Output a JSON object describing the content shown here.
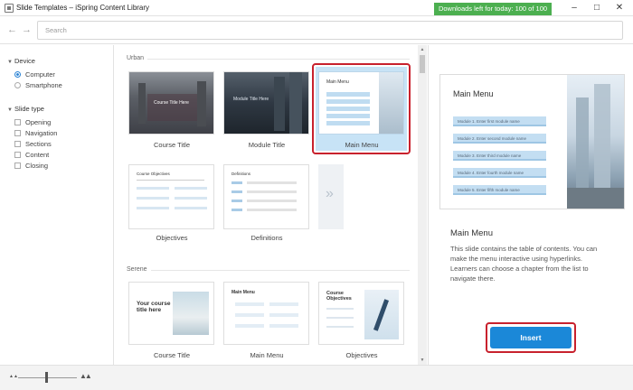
{
  "window": {
    "title": "Slide Templates – iSpring Content Library",
    "downloads": "Downloads left for today: 100 of 100"
  },
  "search": {
    "placeholder": "Search"
  },
  "filters": {
    "device": {
      "label": "Device",
      "options": [
        "Computer",
        "Smartphone"
      ],
      "selected": "Computer"
    },
    "slide_type": {
      "label": "Slide type",
      "options": [
        "Opening",
        "Navigation",
        "Sections",
        "Content",
        "Closing"
      ]
    }
  },
  "gallery": {
    "sections": [
      {
        "name": "Urban",
        "templates": [
          {
            "label": "Course Title",
            "thumb_text": "Course Title Here"
          },
          {
            "label": "Module Title",
            "thumb_text": "Module Title Here"
          },
          {
            "label": "Main Menu",
            "thumb_text": "Main Menu",
            "selected": true
          },
          {
            "label": "Objectives",
            "thumb_text": "Course Objectives"
          },
          {
            "label": "Definitions",
            "thumb_text": "Definitions"
          }
        ]
      },
      {
        "name": "Serene",
        "templates": [
          {
            "label": "Course Title",
            "thumb_text": "Your course title here"
          },
          {
            "label": "Main Menu",
            "thumb_text": "Main Menu"
          },
          {
            "label": "Objectives",
            "thumb_text": "Course Objectives"
          }
        ]
      }
    ]
  },
  "preview": {
    "slide_title": "Main Menu",
    "modules": [
      "Module 1. Enter first module name",
      "Module 2. Enter second module name",
      "Module 3. Enter third module name",
      "Module 4. Enter fourth module name",
      "Module 5. Enter fifth module name"
    ],
    "name": "Main Menu",
    "description": "This slide contains the table of contents. You can make the menu interactive using hyperlinks. Learners can choose a chapter from the list to navigate there.",
    "insert_label": "Insert"
  },
  "colors": {
    "accent": "#1b88d8",
    "highlight": "#c8212d",
    "badge": "#4caf50",
    "selected_bg": "#c7e3f6"
  }
}
